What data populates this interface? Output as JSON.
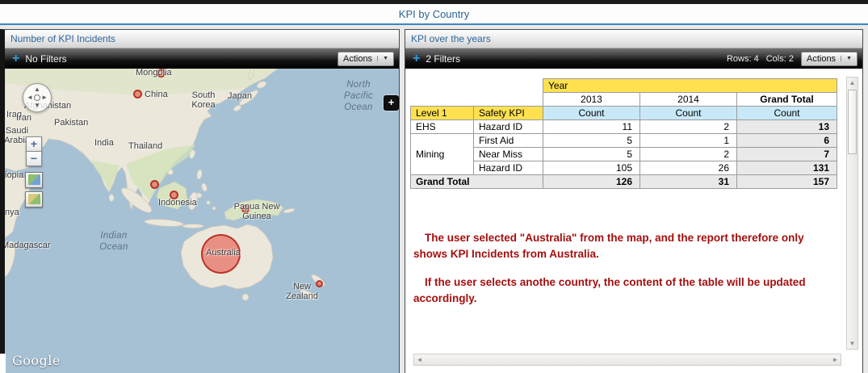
{
  "window": {
    "title": "KPI by Country"
  },
  "left_panel": {
    "title": "Number of KPI Incidents",
    "toolbar": {
      "add_icon": "+",
      "filters_label": "No Filters",
      "actions_label": "Actions",
      "actions_caret": "▼"
    },
    "map": {
      "google_logo": "Google",
      "expand_icon": "+",
      "zoom_in": "+",
      "zoom_out": "−",
      "pan": {
        "up": "▲",
        "down": "▼",
        "left": "◄",
        "right": "►"
      },
      "incident_markers": [
        "Mongolia",
        "China",
        "Indonesia",
        "Indonesia",
        "Papua New Guinea",
        "Australia",
        "New Zealand"
      ],
      "selected_marker": "Australia",
      "labels": {
        "mongolia": "Mongolia",
        "china": "China",
        "japan": "Japan",
        "south_korea": "South Korea",
        "afghanistan": "Afghanistan",
        "iraq": "Iraq",
        "iran": "Iran",
        "pakistan": "Pakistan",
        "saudi_arabia": "Saudi Arabia",
        "india": "India",
        "thailand": "Thailand",
        "indonesia": "Indonesia",
        "papua_new_guinea": "Papua New Guinea",
        "australia": "Australia",
        "new_zealand": "New Zealand",
        "madagascar": "Madagascar",
        "ethiopia_partial": "iopia",
        "kenya_partial": "nya",
        "north_pacific_ocean": "North Pacific Ocean",
        "indian_ocean": "Indian Ocean"
      }
    }
  },
  "right_panel": {
    "title": "KPI over the years",
    "toolbar": {
      "add_icon": "+",
      "filters_label": "2 Filters",
      "rows_label": "Rows: 4",
      "cols_label": "Cols: 2",
      "actions_label": "Actions",
      "actions_caret": "▼"
    },
    "table": {
      "year_label": "Year",
      "columns": [
        "2013",
        "2014",
        "Grand Total"
      ],
      "measure_label": "Count",
      "dims": {
        "level1": "Level 1",
        "kpi": "Safety KPI"
      },
      "rows": [
        {
          "level1": "EHS",
          "kpi": "Hazard ID",
          "y2013": "11",
          "y2014": "2",
          "total": "13"
        },
        {
          "level1": "Mining",
          "kpi": "First Aid",
          "y2013": "5",
          "y2014": "1",
          "total": "6"
        },
        {
          "kpi": "Near Miss",
          "y2013": "5",
          "y2014": "2",
          "total": "7"
        },
        {
          "kpi": "Hazard ID",
          "y2013": "105",
          "y2014": "26",
          "total": "131"
        }
      ],
      "grand_total": {
        "label": "Grand Total",
        "y2013": "126",
        "y2014": "31",
        "total": "157"
      }
    },
    "annotation": {
      "para1": "The user selected \"Australia\" from the map, and the report therefore only shows KPI Incidents from Australia.",
      "para2": "If the user selects anothe country, the content of the table will be updated accordingly."
    },
    "scrollbars": {
      "up": "▲",
      "down": "▼",
      "left": "◄",
      "right": "►"
    }
  },
  "colors": {
    "accent_blue": "#30669A",
    "header_yellow": "#FFE150",
    "count_blue": "#C9E8F7",
    "annotation_red": "#A50F0F",
    "marker_red": "#E8493D"
  }
}
